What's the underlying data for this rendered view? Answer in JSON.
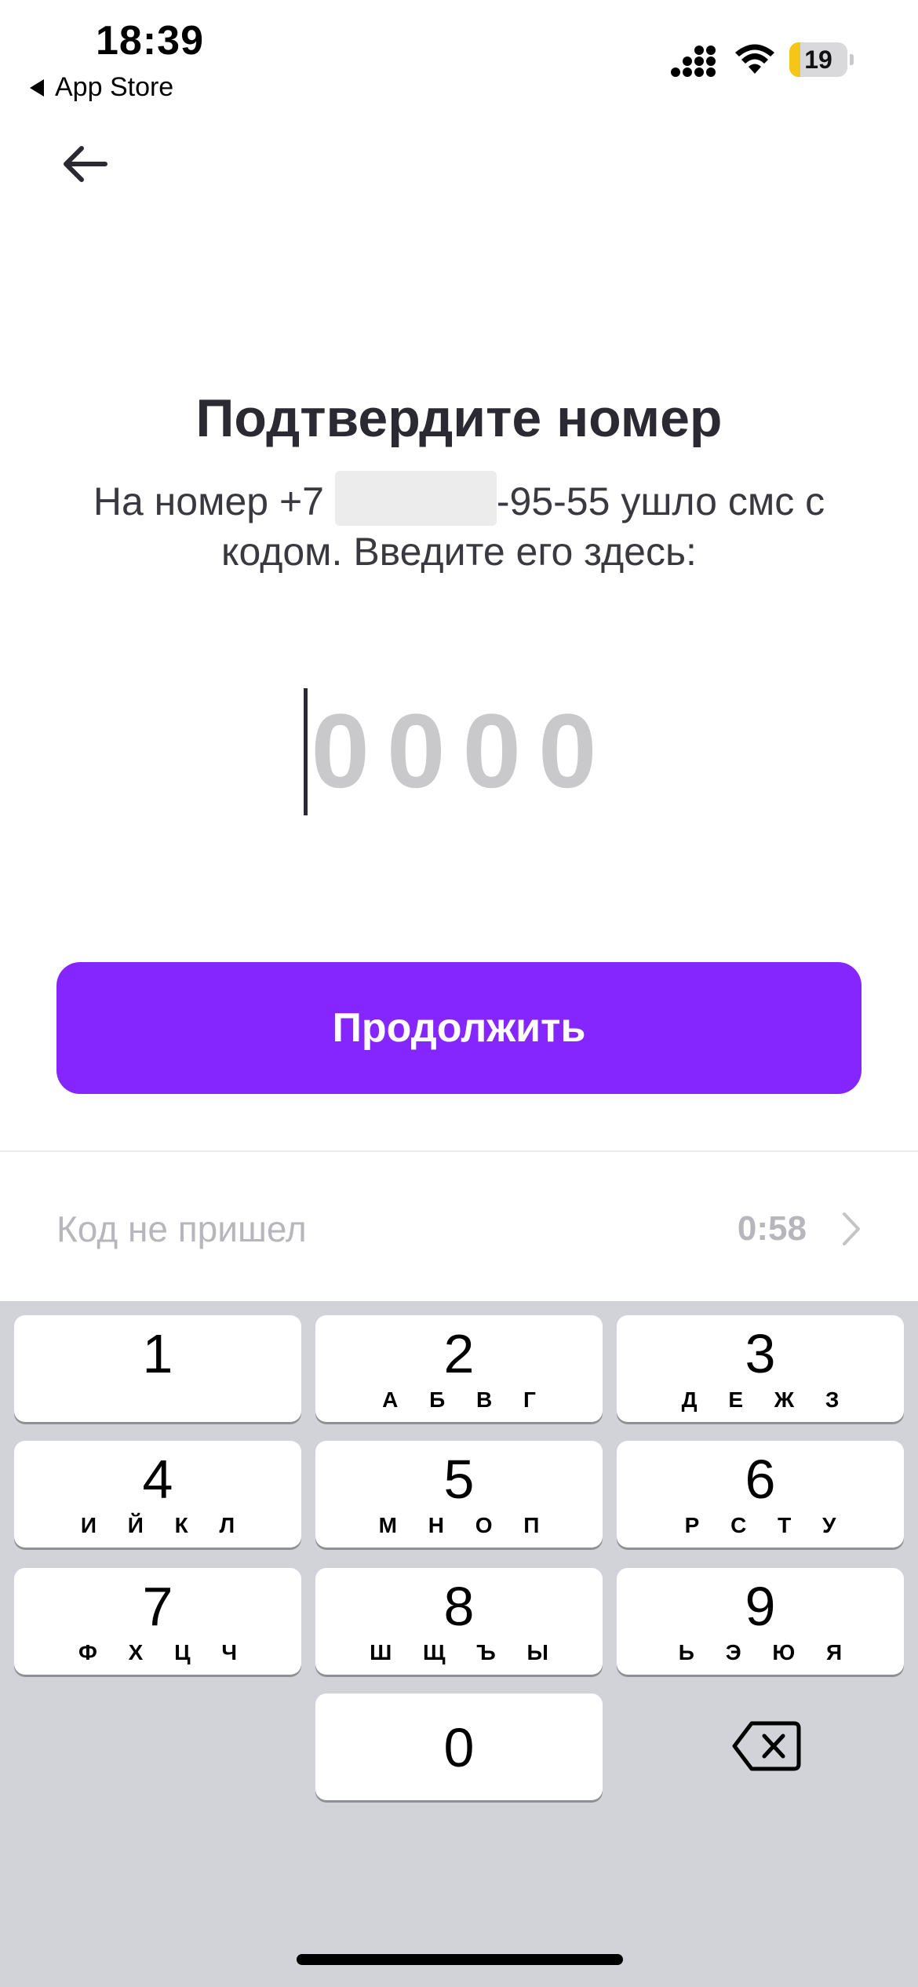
{
  "status_bar": {
    "time": "18:39",
    "back_app": "App Store",
    "battery_level": "19"
  },
  "header": {
    "back_icon": "arrow-left-icon"
  },
  "main": {
    "title": "Подтвердите номер",
    "subtitle_prefix": "На номер +7",
    "subtitle_suffix": "-95-55 ушло смс с кодом. Введите его здесь:",
    "code_placeholder": "0000",
    "code_value": "",
    "continue_label": "Продолжить",
    "resend_label": "Код не пришел",
    "resend_timer": "0:58",
    "accent_color": "#8526ff"
  },
  "keyboard": {
    "keys": [
      {
        "digit": "1",
        "letters": ""
      },
      {
        "digit": "2",
        "letters": "А Б В Г"
      },
      {
        "digit": "3",
        "letters": "Д Е Ж З"
      },
      {
        "digit": "4",
        "letters": "И Й К Л"
      },
      {
        "digit": "5",
        "letters": "М Н О П"
      },
      {
        "digit": "6",
        "letters": "Р С Т У"
      },
      {
        "digit": "7",
        "letters": "Ф Х Ц Ч"
      },
      {
        "digit": "8",
        "letters": "Ш Щ Ъ Ы"
      },
      {
        "digit": "9",
        "letters": "Ь Э Ю Я"
      },
      {
        "digit": "0",
        "letters": ""
      }
    ],
    "delete_icon": "backspace-icon"
  }
}
